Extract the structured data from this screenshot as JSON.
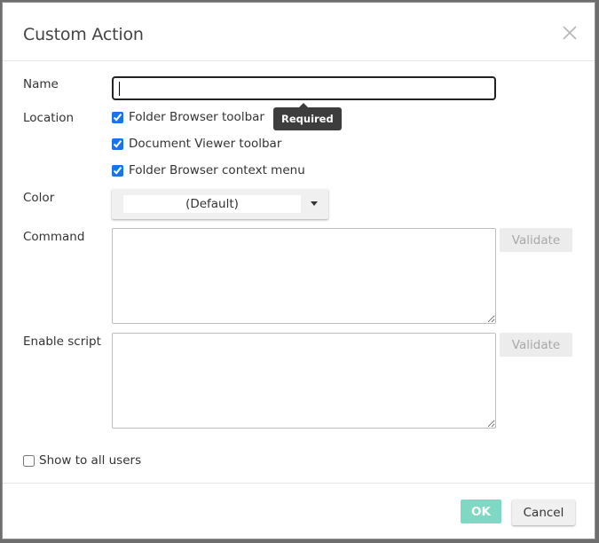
{
  "dialog": {
    "title": "Custom Action",
    "close_icon": "close-icon"
  },
  "form": {
    "name": {
      "label": "Name",
      "value": "",
      "placeholder": "",
      "tooltip": "Required"
    },
    "location": {
      "label": "Location",
      "options": [
        {
          "label": "Folder Browser toolbar",
          "checked": true
        },
        {
          "label": "Document Viewer toolbar",
          "checked": true
        },
        {
          "label": "Folder Browser context menu",
          "checked": true
        }
      ]
    },
    "color": {
      "label": "Color",
      "value": "(Default)"
    },
    "command": {
      "label": "Command",
      "value": "",
      "validate_label": "Validate"
    },
    "enable_script": {
      "label": "Enable script",
      "value": "",
      "validate_label": "Validate"
    },
    "show_to_all": {
      "label": "Show to all users",
      "checked": false
    }
  },
  "footer": {
    "ok_label": "OK",
    "cancel_label": "Cancel"
  },
  "colors": {
    "accent": "#7fd8c4",
    "tooltip_bg": "#3d3d3d"
  }
}
